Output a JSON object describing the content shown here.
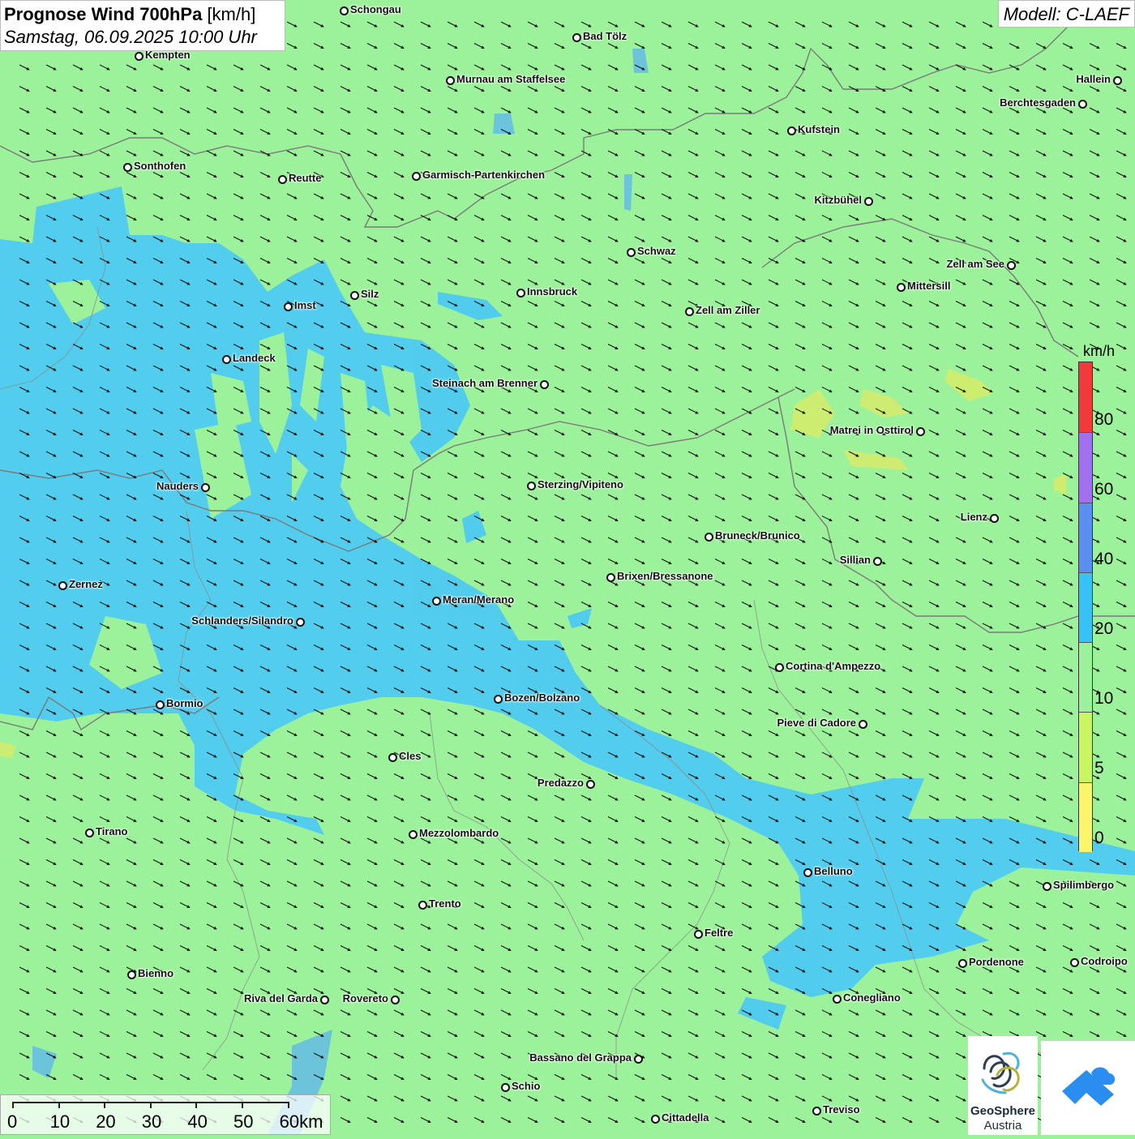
{
  "title": {
    "bold": "Prognose Wind 700hPa",
    "unit": "[km/h]",
    "datetime": "Samstag, 06.09.2025 10:00 Uhr"
  },
  "model": "Modell: C-LAEF",
  "legend": {
    "unit": "km/h",
    "labels": [
      "80",
      "60",
      "40",
      "20",
      "10",
      "5",
      "0"
    ],
    "colors": [
      "#f23a3a",
      "#a070f0",
      "#5a8ef0",
      "#36c2f7",
      "#9cf29a",
      "#c8f560",
      "#fbf56b"
    ]
  },
  "cities": [
    {
      "name": "Schongau"
    },
    {
      "name": "Bad Tölz"
    },
    {
      "name": "Kempten"
    },
    {
      "name": "Hallein"
    },
    {
      "name": "Murnau am Staffelsee"
    },
    {
      "name": "Berchtesgaden"
    },
    {
      "name": "Kufstein"
    },
    {
      "name": "Sonthofen"
    },
    {
      "name": "Reutte"
    },
    {
      "name": "Garmisch-Partenkirchen"
    },
    {
      "name": "Kitzbühel"
    },
    {
      "name": "Schwaz"
    },
    {
      "name": "Zell am See"
    },
    {
      "name": "Mittersill"
    },
    {
      "name": "Silz"
    },
    {
      "name": "Innsbruck"
    },
    {
      "name": "Imst"
    },
    {
      "name": "Zell am Ziller"
    },
    {
      "name": "Landeck"
    },
    {
      "name": "Steinach am Brenner"
    },
    {
      "name": "Matrei in Osttirol"
    },
    {
      "name": "Nauders"
    },
    {
      "name": "Sterzing/Vipiteno"
    },
    {
      "name": "Lienz"
    },
    {
      "name": "Bruneck/Brunico"
    },
    {
      "name": "Sillian"
    },
    {
      "name": "Brixen/Bressanone"
    },
    {
      "name": "Zernez"
    },
    {
      "name": "Meran/Merano"
    },
    {
      "name": "Schlanders/Silandro"
    },
    {
      "name": "Cortina d'Ampezzo"
    },
    {
      "name": "Bozen/Bolzano"
    },
    {
      "name": "Bormio"
    },
    {
      "name": "Pieve di Cadore"
    },
    {
      "name": "Cles"
    },
    {
      "name": "Predazzo"
    },
    {
      "name": "Tirano"
    },
    {
      "name": "Mezzolombardo"
    },
    {
      "name": "Belluno"
    },
    {
      "name": "Spilimbergo"
    },
    {
      "name": "Trento"
    },
    {
      "name": "Feltre"
    },
    {
      "name": "Pordenone"
    },
    {
      "name": "Codroipo"
    },
    {
      "name": "Bienno"
    },
    {
      "name": "Riva del Garda"
    },
    {
      "name": "Rovereto"
    },
    {
      "name": "Conegliano"
    },
    {
      "name": "Bassano del Grappa"
    },
    {
      "name": "Schio"
    },
    {
      "name": "Treviso"
    },
    {
      "name": "Cittadella"
    }
  ],
  "scalebar": {
    "labels": [
      "0",
      "10",
      "20",
      "30",
      "40",
      "50",
      "60km"
    ]
  },
  "logo": {
    "name1": "GeoSphere",
    "name2": "Austria"
  },
  "wind": {
    "direction": "from northwest (arrows pointing southeast)"
  }
}
